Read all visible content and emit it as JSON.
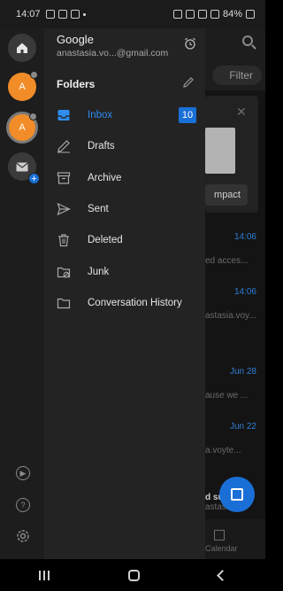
{
  "status_bar": {
    "time": "14:07",
    "battery": "84%"
  },
  "account": {
    "name": "Google",
    "email": "anastasia.vo...@gmail.com",
    "avatar_initial": "A"
  },
  "folders": {
    "title": "Folders",
    "items": [
      {
        "label": "Inbox",
        "count": "10",
        "icon": "inbox-icon",
        "active": true
      },
      {
        "label": "Drafts",
        "icon": "drafts-icon"
      },
      {
        "label": "Archive",
        "icon": "archive-icon"
      },
      {
        "label": "Sent",
        "icon": "sent-icon"
      },
      {
        "label": "Deleted",
        "icon": "trash-icon"
      },
      {
        "label": "Junk",
        "icon": "junk-icon"
      },
      {
        "label": "Conversation History",
        "icon": "folder-icon"
      }
    ]
  },
  "background": {
    "filter_label": "Filter",
    "card_button": "mpact",
    "rows": [
      {
        "date": "14:06",
        "snippet": "ed acces..."
      },
      {
        "date": "14:06",
        "snippet": "astasia.voy..."
      },
      {
        "date": "Jun 28",
        "snippet": "ause we ..."
      },
      {
        "date": "Jun 22",
        "snippet": "a.voyte..."
      }
    ],
    "bottom_snippet_1": "d su",
    "bottom_snippet_2": "astasia.",
    "calendar_label": "Calendar"
  },
  "colors": {
    "accent": "#1a6fd6",
    "active_text": "#2f8cf0",
    "avatar": "#f28c28",
    "drawer_bg": "#232323"
  }
}
